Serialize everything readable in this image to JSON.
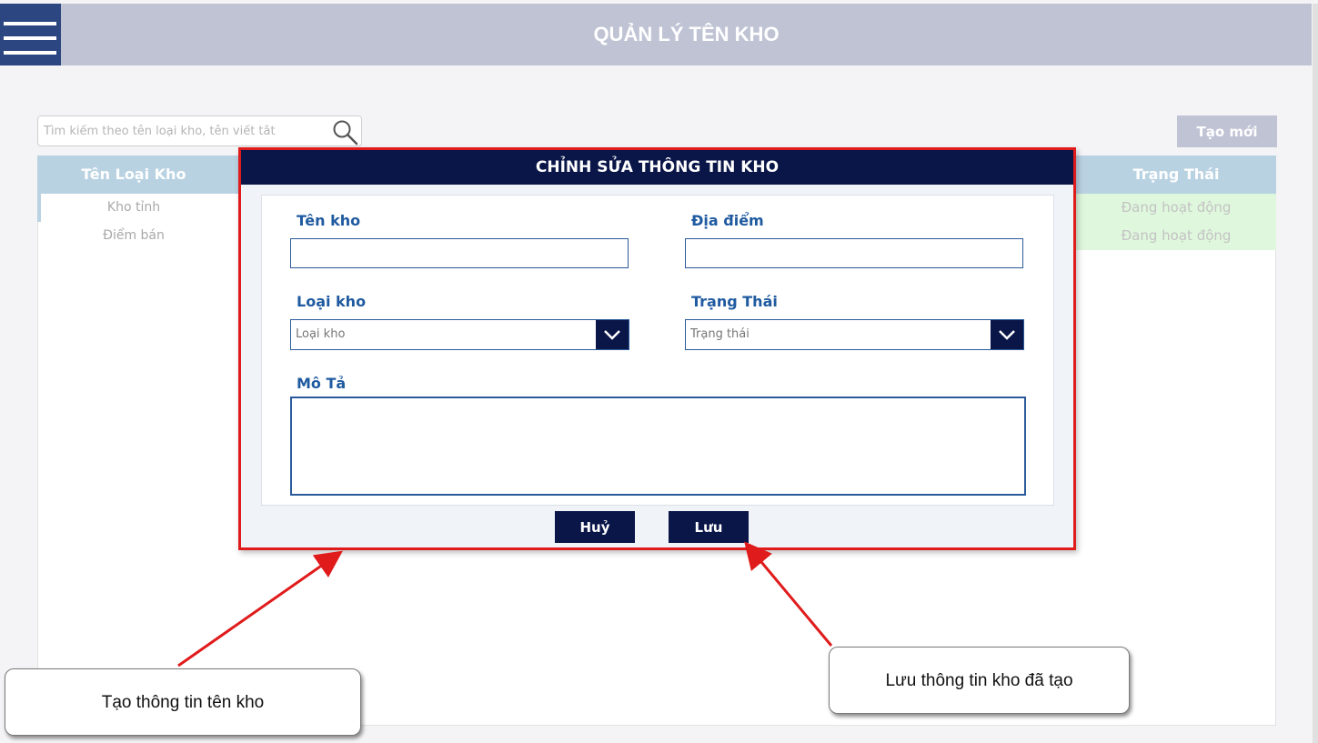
{
  "app": {
    "title": "QUẢN LÝ TÊN KHO"
  },
  "search": {
    "placeholder": "Tìm kiếm theo tên loại kho, tên viết tắt"
  },
  "toolbar": {
    "create_label": "Tạo mới"
  },
  "table": {
    "columns": [
      "Tên Loại Kho",
      "Trạng Thái"
    ],
    "rows": [
      {
        "name": "Kho tỉnh",
        "status": "Đang hoạt động"
      },
      {
        "name": "Điểm bán",
        "status": "Đang hoạt động"
      }
    ]
  },
  "modal": {
    "title": "CHỈNH SỬA THÔNG TIN KHO",
    "fields": {
      "name_label": "Tên kho",
      "name_value": "",
      "location_label": "Địa điểm",
      "location_value": "",
      "type_label": "Loại kho",
      "type_value": "Loại kho",
      "status_label": "Trạng Thái",
      "status_value": "Trạng thái",
      "description_label": "Mô Tả",
      "description_value": ""
    },
    "cancel_label": "Huỷ",
    "save_label": "Lưu"
  },
  "annotations": {
    "create_note": "Tạo thông tin tên kho",
    "save_note": "Lưu thông tin kho đã tạo"
  },
  "colors": {
    "header_bar": "#bfc3d4",
    "menu_button": "#2c4681",
    "modal_header": "#0a1548",
    "highlight_border": "#e01b1b",
    "label_blue": "#1f5aa0",
    "status_bg": "#dff7dd"
  },
  "icons": {
    "menu": "hamburger-icon",
    "search": "search-icon",
    "dropdown": "chevron-down-icon"
  }
}
